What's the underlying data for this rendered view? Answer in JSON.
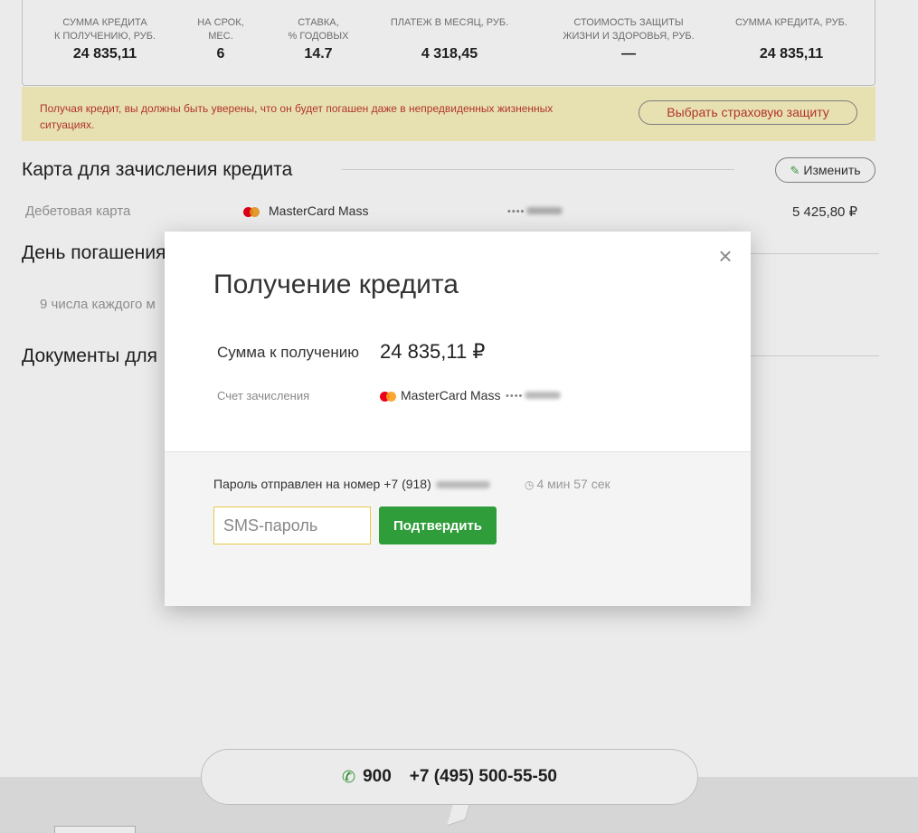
{
  "summary": {
    "columns": [
      {
        "label": "Сумма кредита\nк получению, руб.",
        "value": "24 835,11"
      },
      {
        "label": "На срок,\nмес.",
        "value": "6"
      },
      {
        "label": "Ставка,\n% годовых",
        "value": "14.7"
      },
      {
        "label": "Платеж в месяц, руб.",
        "value": "4 318,45"
      },
      {
        "label": "Стоимость защиты\nжизни и здоровья, руб.",
        "value": "—"
      },
      {
        "label": "Сумма кредита, руб.",
        "value": "24 835,11"
      }
    ]
  },
  "warning": {
    "text": "Получая кредит, вы должны быть уверены, что он будет погашен даже в непредвиденных жизненных ситуациях.",
    "button_label": "Выбрать страховую защиту"
  },
  "card_section": {
    "title": "Карта для зачисления кредита",
    "edit_label": "Изменить",
    "card_type": "Дебетовая карта",
    "card_name": "MasterCard Mass",
    "card_mask": "••••",
    "balance": "5 425,80 ₽"
  },
  "repay_section": {
    "title": "День погашения",
    "text": "9 числа каждого м"
  },
  "docs_section": {
    "title": "Документы для"
  },
  "modal": {
    "title": "Получение кредита",
    "amount_label": "Сумма к получению",
    "amount_value": "24 835,11 ₽",
    "account_label": "Счет зачисления",
    "card_name": "MasterCard Mass",
    "card_mask": "••••",
    "sms_sent_text": "Пароль отправлен на номер +7 (918)",
    "timer": "4 мин 57 сек",
    "sms_placeholder": "SMS-пароль",
    "confirm_label": "Подтвердить"
  },
  "footer": {
    "short_number": "900",
    "long_number": "+7 (495) 500-55-50"
  }
}
